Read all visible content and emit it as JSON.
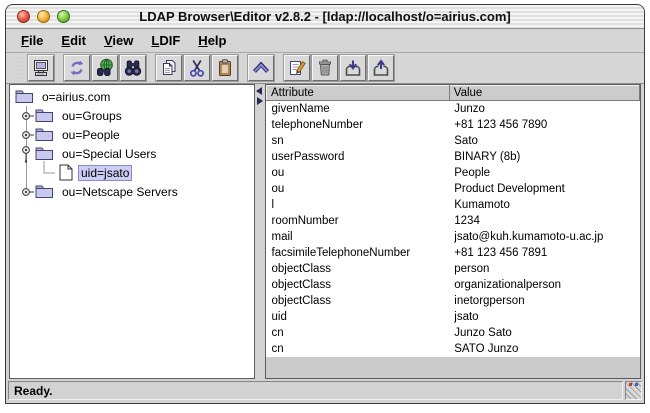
{
  "window": {
    "title": "LDAP Browser\\Editor v2.8.2 - [ldap://localhost/o=airius.com]",
    "traffic_lights": [
      "close",
      "minimize",
      "zoom"
    ]
  },
  "menu": {
    "items": [
      {
        "label": "File"
      },
      {
        "label": "Edit"
      },
      {
        "label": "View"
      },
      {
        "label": "LDIF"
      },
      {
        "label": "Help"
      }
    ]
  },
  "toolbar": {
    "buttons": [
      {
        "name": "connect",
        "icon": "monitor-icon",
        "group": 1
      },
      {
        "name": "refresh",
        "icon": "refresh-icon",
        "group": 2
      },
      {
        "name": "search-directory",
        "icon": "binoculars-globe-icon",
        "group": 2
      },
      {
        "name": "search",
        "icon": "binoculars-icon",
        "group": 2
      },
      {
        "name": "copy",
        "icon": "copy-icon",
        "group": 3
      },
      {
        "name": "cut",
        "icon": "scissors-icon",
        "group": 3
      },
      {
        "name": "paste",
        "icon": "clipboard-icon",
        "group": 3
      },
      {
        "name": "up-one-level",
        "icon": "chevron-up-icon",
        "group": 4
      },
      {
        "name": "edit-entry",
        "icon": "edit-pencil-icon",
        "group": 5
      },
      {
        "name": "delete-entry",
        "icon": "trash-icon",
        "group": 5
      },
      {
        "name": "import-ldif",
        "icon": "import-icon",
        "group": 5
      },
      {
        "name": "export-ldif",
        "icon": "export-icon",
        "group": 5
      }
    ]
  },
  "tree": {
    "items": [
      {
        "label": "o=airius.com",
        "icon": "folder-icon",
        "level": 0,
        "toggle": "none",
        "selected": false
      },
      {
        "label": "ou=Groups",
        "icon": "folder-icon",
        "level": 1,
        "toggle": "collapsed",
        "selected": false
      },
      {
        "label": "ou=People",
        "icon": "folder-icon",
        "level": 1,
        "toggle": "collapsed",
        "selected": false
      },
      {
        "label": "ou=Special Users",
        "icon": "folder-icon",
        "level": 1,
        "toggle": "expanded",
        "selected": false
      },
      {
        "label": "uid=jsato",
        "icon": "document-icon",
        "level": 2,
        "toggle": "none",
        "selected": true
      },
      {
        "label": "ou=Netscape Servers",
        "icon": "folder-icon",
        "level": 1,
        "toggle": "collapsed",
        "selected": false
      }
    ]
  },
  "attributes_table": {
    "columns": [
      "Attribute",
      "Value"
    ],
    "rows": [
      [
        "givenName",
        "Junzo"
      ],
      [
        "telephoneNumber",
        "+81 123 456 7890"
      ],
      [
        "sn",
        "Sato"
      ],
      [
        "userPassword",
        "BINARY (8b)"
      ],
      [
        "ou",
        "People"
      ],
      [
        "ou",
        "Product Development"
      ],
      [
        "l",
        "Kumamoto"
      ],
      [
        "roomNumber",
        "1234"
      ],
      [
        "mail",
        "jsato@kuh.kumamoto-u.ac.jp"
      ],
      [
        "facsimileTelephoneNumber",
        "+81 123 456 7891"
      ],
      [
        "objectClass",
        "person"
      ],
      [
        "objectClass",
        "organizationalperson"
      ],
      [
        "objectClass",
        "inetorgperson"
      ],
      [
        "uid",
        "jsato"
      ],
      [
        "cn",
        "Junzo Sato"
      ],
      [
        "cn",
        "SATO Junzo"
      ]
    ]
  },
  "status": {
    "text": "Ready."
  },
  "colors": {
    "selection_bg": "#ccccf4",
    "selection_border": "#8888cc",
    "folder_fill": "#c8c8f0",
    "table_header_bg": "#cccccc",
    "panel_bg": "#d2d2d2",
    "titlebar_stripe": "#e0e0e0",
    "traffic_red": "#e85a4a",
    "traffic_yellow": "#f3b53c",
    "traffic_green": "#7fce48",
    "icon_accent_blue": "#5c5cc0"
  }
}
